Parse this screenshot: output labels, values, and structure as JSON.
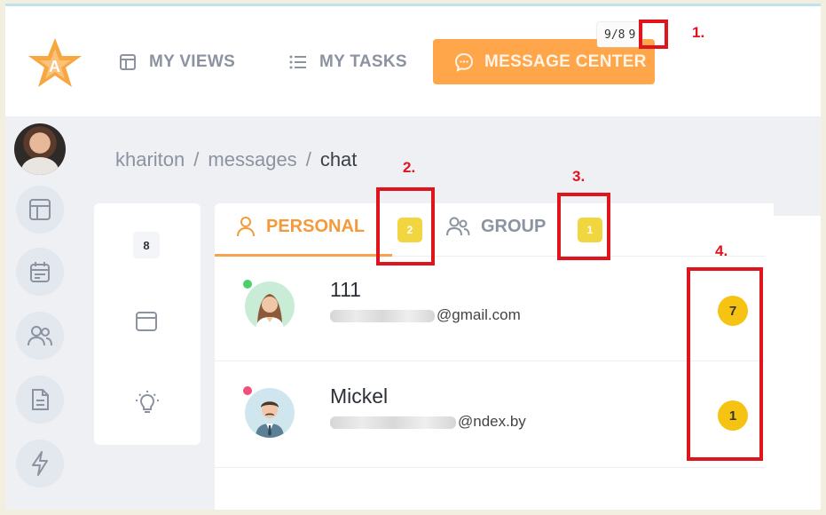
{
  "header": {
    "nav": {
      "my_views": "MY VIEWS",
      "my_tasks": "MY TASKS",
      "message_center": "MESSAGE CENTER"
    },
    "counter": {
      "text": "9/8",
      "highlighted": "9"
    }
  },
  "annotations": [
    "1.",
    "2.",
    "3.",
    "4."
  ],
  "breadcrumb": [
    "khariton",
    "messages",
    "chat"
  ],
  "breadcrumb_separator": "/",
  "left_panel": {
    "badge": "8"
  },
  "tabs": [
    {
      "label": "PERSONAL",
      "badge": "2",
      "active": true
    },
    {
      "label": "GROUP",
      "badge": "1",
      "active": false
    }
  ],
  "chats": [
    {
      "name": "111",
      "email_visible": "gmail.com",
      "email_prefix": "@",
      "unread": "7",
      "status_color": "#4cd06a"
    },
    {
      "name": "Mickel",
      "email_visible": "ndex.by",
      "email_prefix": "@",
      "unread": "1",
      "status_color": "#f0507a"
    }
  ],
  "colors": {
    "accent": "#ffa54a",
    "badge_yellow": "#f1d640",
    "unread_yellow": "#f6c313",
    "annotation_red": "#e0141d"
  },
  "icons": {
    "sidebar": [
      "layout-icon",
      "calendar-icon",
      "users-icon",
      "document-icon",
      "lightning-icon"
    ],
    "left_panel": [
      "window-icon",
      "lightbulb-icon"
    ]
  }
}
